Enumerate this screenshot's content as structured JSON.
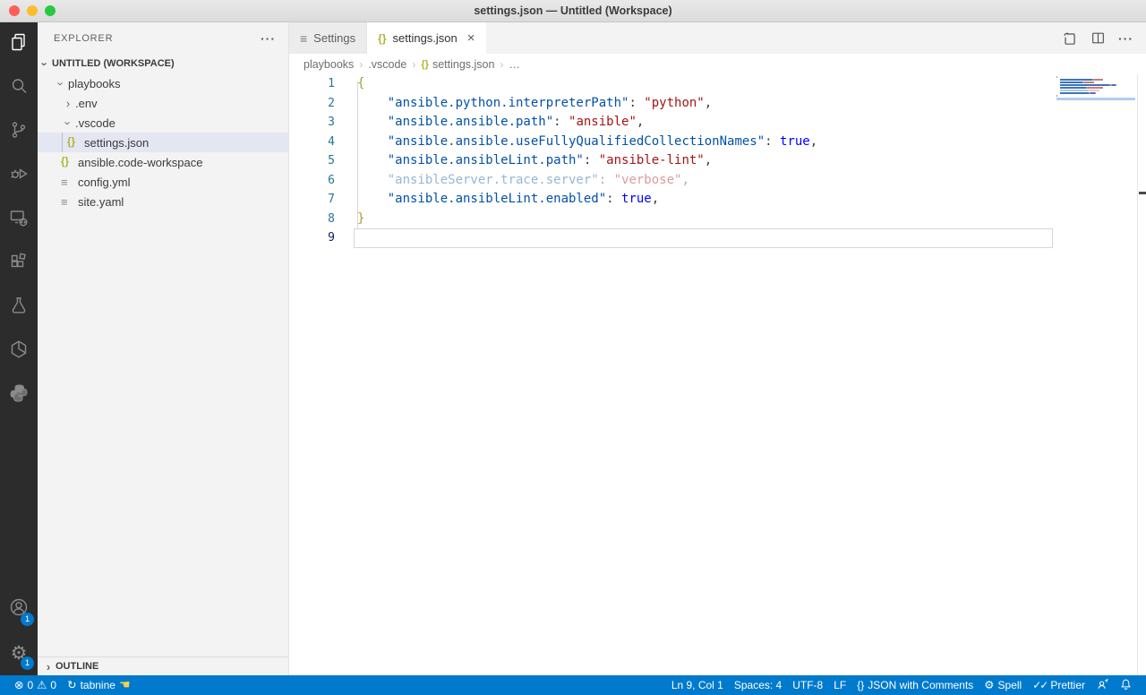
{
  "window": {
    "title": "settings.json — Untitled (Workspace)"
  },
  "colors": {
    "accent": "#007acc",
    "json_icon": "#b0b32f",
    "code_key": "#0451a5",
    "code_string": "#a31515",
    "code_bool": "#0000ff",
    "code_brace": "#a3a138",
    "statusbar_bg": "#007acc",
    "activitybar_bg": "#2c2c2c"
  },
  "activity_bar": {
    "items": [
      {
        "name": "explorer",
        "active": true
      },
      {
        "name": "search",
        "active": false
      },
      {
        "name": "source-control",
        "active": false
      },
      {
        "name": "run-debug",
        "active": false
      },
      {
        "name": "remote-explorer",
        "active": false
      },
      {
        "name": "extensions",
        "active": false
      },
      {
        "name": "testing",
        "active": false
      },
      {
        "name": "collections",
        "active": false
      },
      {
        "name": "python",
        "active": false
      }
    ],
    "accounts_badge": "1",
    "manage_badge": "1"
  },
  "sidebar": {
    "title": "EXPLORER",
    "more_label": "···",
    "section_label": "UNTITLED (WORKSPACE)",
    "tree": [
      {
        "label": "playbooks",
        "kind": "folder",
        "expanded": true,
        "indent": 1
      },
      {
        "label": ".env",
        "kind": "folder",
        "expanded": false,
        "indent": 2
      },
      {
        "label": ".vscode",
        "kind": "folder",
        "expanded": true,
        "indent": 2
      },
      {
        "label": "settings.json",
        "kind": "json",
        "indent": 3,
        "selected": true,
        "guide": true
      },
      {
        "label": "ansible.code-workspace",
        "kind": "json",
        "indent": 2
      },
      {
        "label": "config.yml",
        "kind": "yaml",
        "indent": 2
      },
      {
        "label": "site.yaml",
        "kind": "yaml",
        "indent": 2
      }
    ],
    "outline_label": "OUTLINE"
  },
  "tabs": {
    "settings_label": "Settings",
    "file_label": "settings.json",
    "close_glyph": "×"
  },
  "editor_actions": {
    "more_label": "···"
  },
  "breadcrumbs": {
    "items": [
      "playbooks",
      ".vscode",
      "settings.json",
      "…"
    ],
    "json_glyph": "{}"
  },
  "editor": {
    "lines": [
      {
        "num": "1",
        "segs": [
          {
            "c": "brace",
            "t": "{"
          }
        ]
      },
      {
        "num": "2",
        "segs": [
          {
            "c": "plain",
            "t": "    "
          },
          {
            "c": "key",
            "t": "\"ansible.python.interpreterPath\""
          },
          {
            "c": "punct",
            "t": ": "
          },
          {
            "c": "str",
            "t": "\"python\""
          },
          {
            "c": "punct",
            "t": ","
          }
        ]
      },
      {
        "num": "3",
        "segs": [
          {
            "c": "plain",
            "t": "    "
          },
          {
            "c": "key",
            "t": "\"ansible.ansible.path\""
          },
          {
            "c": "punct",
            "t": ": "
          },
          {
            "c": "str",
            "t": "\"ansible\""
          },
          {
            "c": "punct",
            "t": ","
          }
        ]
      },
      {
        "num": "4",
        "segs": [
          {
            "c": "plain",
            "t": "    "
          },
          {
            "c": "key",
            "t": "\"ansible.ansible.useFullyQualifiedCollectionNames\""
          },
          {
            "c": "punct",
            "t": ": "
          },
          {
            "c": "bool",
            "t": "true"
          },
          {
            "c": "punct",
            "t": ","
          }
        ]
      },
      {
        "num": "5",
        "segs": [
          {
            "c": "plain",
            "t": "    "
          },
          {
            "c": "key",
            "t": "\"ansible.ansibleLint.path\""
          },
          {
            "c": "punct",
            "t": ": "
          },
          {
            "c": "str",
            "t": "\"ansible-lint\""
          },
          {
            "c": "punct",
            "t": ","
          }
        ]
      },
      {
        "num": "6",
        "faded": true,
        "segs": [
          {
            "c": "plain",
            "t": "    "
          },
          {
            "c": "key",
            "t": "\"ansibleServer.trace.server\""
          },
          {
            "c": "punct",
            "t": ": "
          },
          {
            "c": "str",
            "t": "\"verbose\""
          },
          {
            "c": "punct",
            "t": ","
          }
        ]
      },
      {
        "num": "7",
        "segs": [
          {
            "c": "plain",
            "t": "    "
          },
          {
            "c": "key",
            "t": "\"ansible.ansibleLint.enabled\""
          },
          {
            "c": "punct",
            "t": ": "
          },
          {
            "c": "bool",
            "t": "true"
          },
          {
            "c": "punct",
            "t": ","
          }
        ]
      },
      {
        "num": "8",
        "segs": [
          {
            "c": "brace",
            "t": "}"
          }
        ]
      },
      {
        "num": "9",
        "current": true,
        "segs": []
      }
    ]
  },
  "status_bar": {
    "errors": "0",
    "warnings": "0",
    "tabnine_label": "tabnine",
    "cursor": "Ln 9, Col 1",
    "indentation": "Spaces: 4",
    "encoding": "UTF-8",
    "eol": "LF",
    "language": "JSON with Comments",
    "language_glyph": "{}",
    "spell_label": "Spell",
    "prettier_label": "Prettier"
  }
}
